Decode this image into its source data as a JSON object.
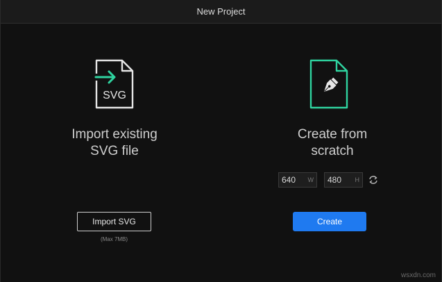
{
  "window": {
    "title": "New Project"
  },
  "import_panel": {
    "icon": "svg-import-file-icon",
    "icon_text": "SVG",
    "icon_color": "#e6e6e6",
    "arrow_color": "#2fd4a0",
    "title": "Import existing\nSVG file",
    "button_label": "Import SVG",
    "note": "(Max 7MB)"
  },
  "create_panel": {
    "icon": "pen-tool-file-icon",
    "icon_color": "#2fd4a0",
    "title": "Create from\nscratch",
    "width_value": "640",
    "width_unit": "W",
    "height_value": "480",
    "height_unit": "H",
    "link_icon": "swap-icon",
    "button_label": "Create",
    "button_color": "#1f7af0"
  },
  "watermark": "wsxdn.com"
}
